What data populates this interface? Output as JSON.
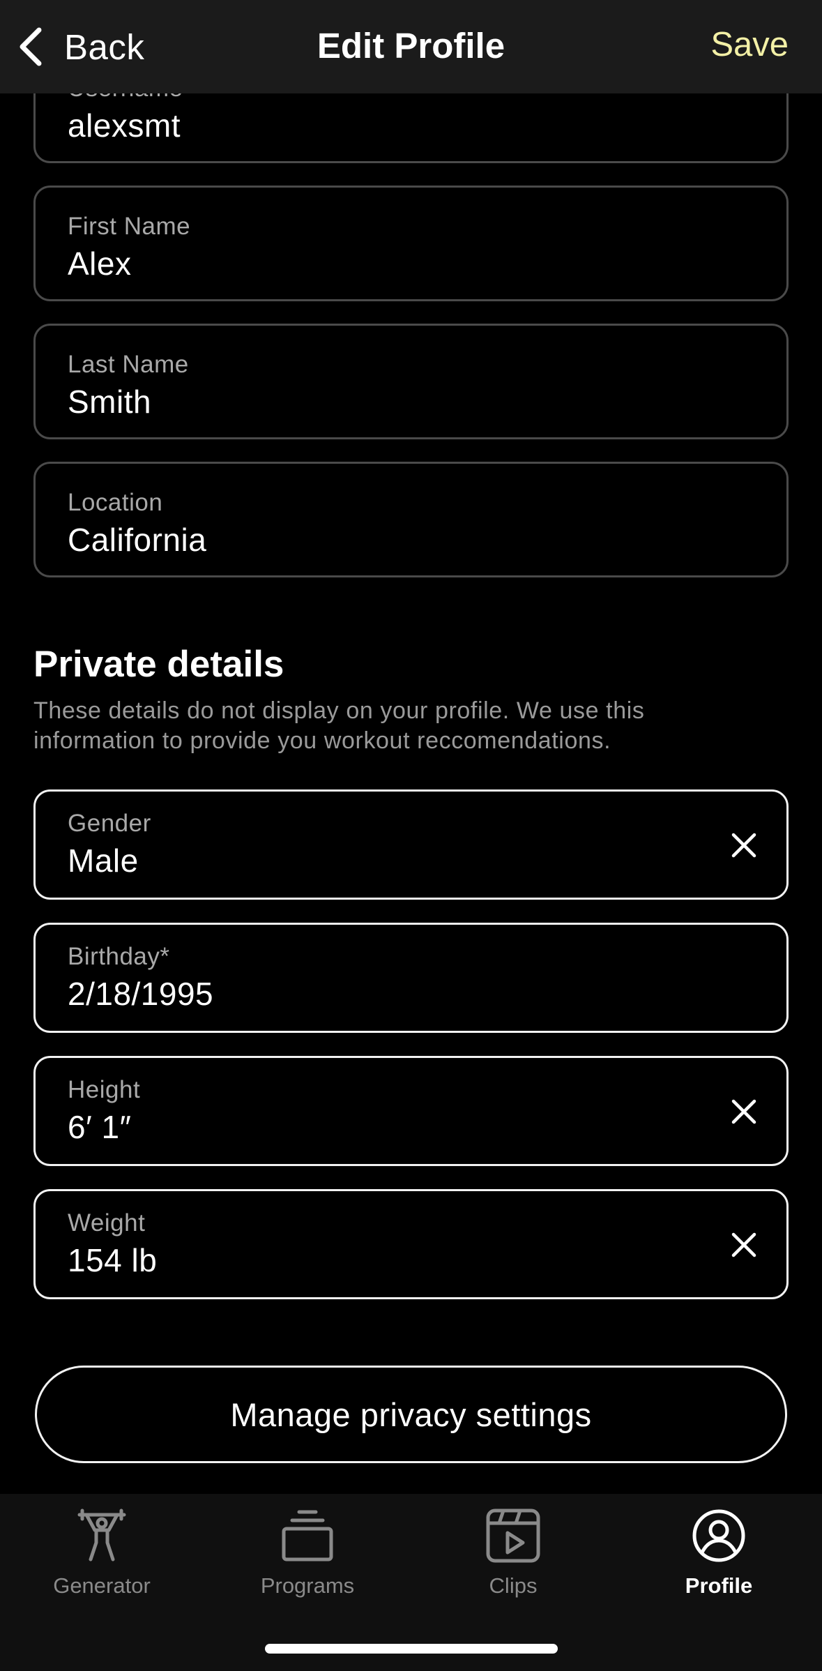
{
  "header": {
    "back_label": "Back",
    "title": "Edit Profile",
    "save_label": "Save",
    "save_color": "#f3f0a6"
  },
  "public_fields": [
    {
      "label": "Username",
      "value": "alexsmt"
    },
    {
      "label": "First Name",
      "value": "Alex"
    },
    {
      "label": "Last Name",
      "value": "Smith"
    },
    {
      "label": "Location",
      "value": "California"
    }
  ],
  "private_section": {
    "title": "Private details",
    "description": "These details do not display on your profile. We use this information to provide you workout reccomendations.",
    "fields": [
      {
        "label": "Gender",
        "value": "Male",
        "clear_icon": "close-icon"
      },
      {
        "label": "Birthday*",
        "value": "2/18/1995"
      },
      {
        "label": "Height",
        "value": "6′ 1″",
        "clear_icon": "close-icon"
      },
      {
        "label": "Weight",
        "value": "154 lb",
        "clear_icon": "close-icon"
      }
    ]
  },
  "privacy_button_label": "Manage privacy settings",
  "tabbar": {
    "tabs": [
      {
        "label": "Generator",
        "icon": "weightlifter-icon",
        "active": false
      },
      {
        "label": "Programs",
        "icon": "stack-icon",
        "active": false
      },
      {
        "label": "Clips",
        "icon": "video-clip-icon",
        "active": false
      },
      {
        "label": "Profile",
        "icon": "profile-icon",
        "active": true
      }
    ]
  }
}
